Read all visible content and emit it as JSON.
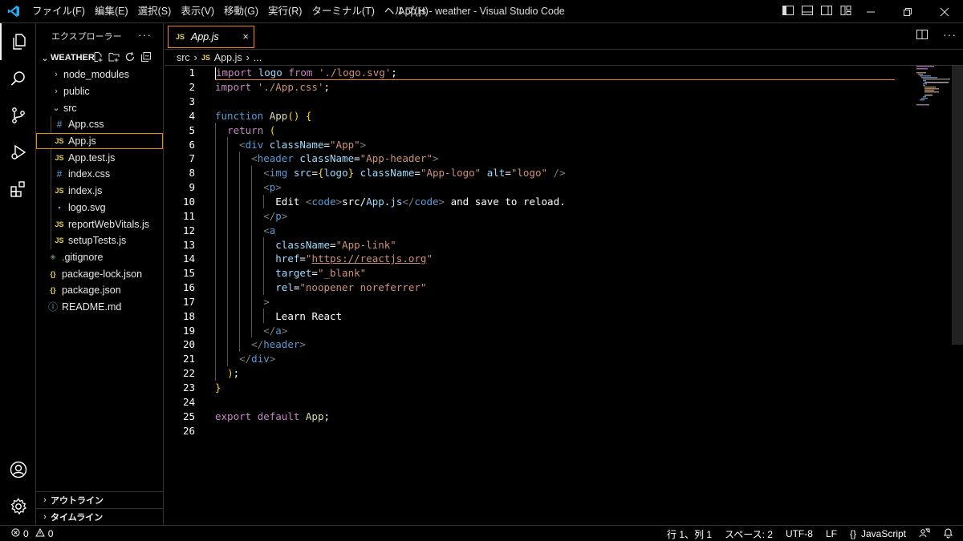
{
  "titlebar": {
    "title": "App.js - weather - Visual Studio Code",
    "menu": [
      "ファイル(F)",
      "編集(E)",
      "選択(S)",
      "表示(V)",
      "移動(G)",
      "実行(R)",
      "ターミナル(T)",
      "ヘルプ(H)"
    ]
  },
  "sidebar": {
    "header": "エクスプローラー",
    "more": "···",
    "folder": "WEATHER",
    "tree": [
      {
        "label": "node_modules",
        "kind": "folder-closed"
      },
      {
        "label": "public",
        "kind": "folder-closed"
      },
      {
        "label": "src",
        "kind": "folder-open"
      },
      {
        "label": "App.css",
        "kind": "css"
      },
      {
        "label": "App.js",
        "kind": "js"
      },
      {
        "label": "App.test.js",
        "kind": "js"
      },
      {
        "label": "index.css",
        "kind": "css"
      },
      {
        "label": "index.js",
        "kind": "js"
      },
      {
        "label": "logo.svg",
        "kind": "svg"
      },
      {
        "label": "reportWebVitals.js",
        "kind": "js"
      },
      {
        "label": "setupTests.js",
        "kind": "js"
      },
      {
        "label": ".gitignore",
        "kind": "git"
      },
      {
        "label": "package-lock.json",
        "kind": "json"
      },
      {
        "label": "package.json",
        "kind": "json"
      },
      {
        "label": "README.md",
        "kind": "info"
      }
    ],
    "outline": "アウトライン",
    "timeline": "タイムライン"
  },
  "editor": {
    "tab": {
      "icon": "JS",
      "title": "App.js",
      "close": "×"
    },
    "breadcrumb": {
      "folder": "src",
      "sep": "›",
      "icon": "JS",
      "file": "App.js",
      "tail": "..."
    }
  },
  "icons": {
    "js": "JS",
    "css": "#",
    "json": "{}",
    "svg": "▪",
    "git": "◈",
    "info": "ⓘ"
  },
  "code": {
    "line_numbers": [
      "1",
      "2",
      "3",
      "4",
      "5",
      "6",
      "7",
      "8",
      "9",
      "10",
      "11",
      "12",
      "13",
      "14",
      "15",
      "16",
      "17",
      "18",
      "19",
      "20",
      "21",
      "22",
      "23",
      "24",
      "25",
      "26"
    ],
    "lines": [
      "import logo from './logo.svg';",
      "import './App.css';",
      "",
      "function App() {",
      "  return (",
      "    <div className=\"App\">",
      "      <header className=\"App-header\">",
      "        <img src={logo} className=\"App-logo\" alt=\"logo\" />",
      "        <p>",
      "          Edit <code>src/App.js</code> and save to reload.",
      "        </p>",
      "        <a",
      "          className=\"App-link\"",
      "          href=\"https://reactjs.org\"",
      "          target=\"_blank\"",
      "          rel=\"noopener noreferrer\"",
      "        >",
      "          Learn React",
      "        </a>",
      "      </header>",
      "    </div>",
      "  );",
      "}",
      "",
      "export default App;",
      ""
    ]
  },
  "status": {
    "errors": "0",
    "warnings": "0",
    "position": "行 1、列 1",
    "indent": "スペース: 2",
    "encoding": "UTF-8",
    "eol": "LF",
    "language_icon": "{}",
    "language": "JavaScript"
  },
  "colors": {
    "accent_border": "#f38518",
    "background": "#000000",
    "keyword": "#c586c0",
    "tag": "#569cd6",
    "string": "#ce9178",
    "variable": "#9cdcfe"
  }
}
